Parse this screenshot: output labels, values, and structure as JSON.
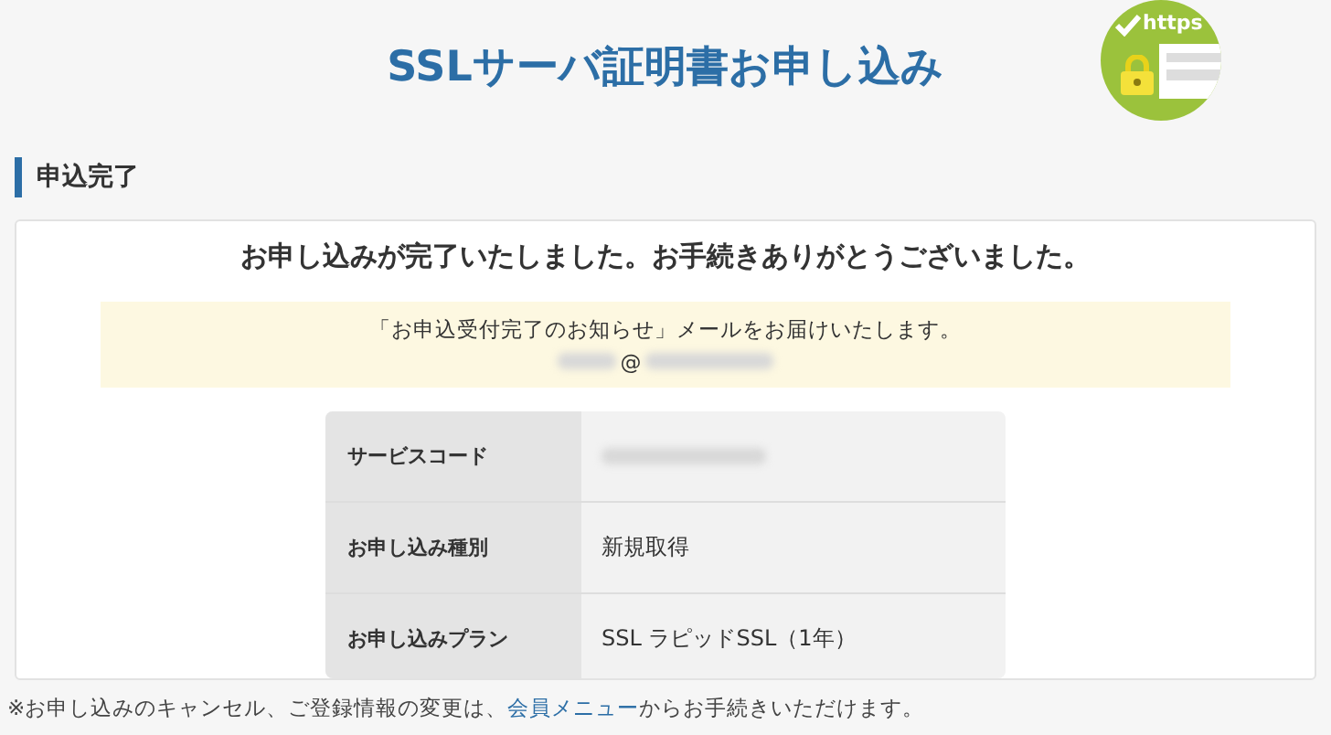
{
  "header": {
    "title": "SSLサーバ証明書お申し込み",
    "logo_text": "https"
  },
  "section": {
    "heading": "申込完了"
  },
  "card": {
    "message": "お申し込みが完了いたしました。お手続きありがとうございました。",
    "notice": {
      "text": "「お申込受付完了のお知らせ」メールをお届けいたします。",
      "email_at": "@"
    },
    "table": {
      "rows": [
        {
          "label": "サービスコード",
          "kind": "redacted"
        },
        {
          "label": "お申し込み種別",
          "kind": "text",
          "value": "新規取得"
        },
        {
          "label": "お申し込みプラン",
          "kind": "text",
          "value": "SSL ラピッドSSL（1年）"
        }
      ]
    }
  },
  "footer": {
    "before": "※お申し込みのキャンセル、ご登録情報の変更は、",
    "link": "会員メニュー",
    "after": "からお手続きいただけます。"
  }
}
